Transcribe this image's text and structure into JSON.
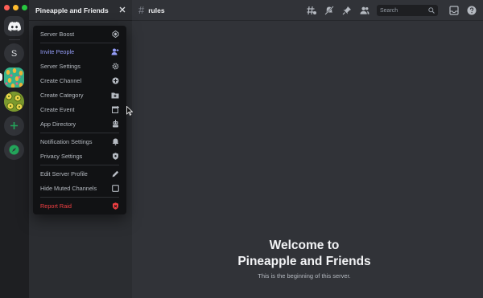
{
  "window": {
    "traffic_lights": [
      "close",
      "minimize",
      "zoom"
    ]
  },
  "rail": {
    "home_icon": "discord-logo-icon",
    "servers": [
      {
        "label": "S"
      },
      {
        "label": "",
        "icon": "pineapple-pattern-server-icon"
      },
      {
        "label": "",
        "icon": "pineapple-slices-server-icon"
      }
    ],
    "add_icon": "plus-icon",
    "explore_icon": "compass-icon"
  },
  "sidebar": {
    "server_name": "Pineapple and Friends",
    "close_icon": "close-icon"
  },
  "menu": {
    "items": [
      {
        "label": "Server Boost",
        "icon": "boost-gem-icon"
      },
      {
        "label": "Invite People",
        "icon": "add-person-icon",
        "accent": true
      },
      {
        "label": "Server Settings",
        "icon": "gear-icon"
      },
      {
        "label": "Create Channel",
        "icon": "plus-circle-icon"
      },
      {
        "label": "Create Category",
        "icon": "folder-plus-icon"
      },
      {
        "label": "Create Event",
        "icon": "calendar-plus-icon"
      },
      {
        "label": "App Directory",
        "icon": "robot-icon"
      },
      {
        "label": "Notification Settings",
        "icon": "bell-icon"
      },
      {
        "label": "Privacy Settings",
        "icon": "shield-icon"
      },
      {
        "label": "Edit Server Profile",
        "icon": "pencil-icon"
      },
      {
        "label": "Hide Muted Channels",
        "icon": "checkbox-icon"
      },
      {
        "label": "Report Raid",
        "icon": "shield-alert-icon",
        "danger": true
      }
    ]
  },
  "main": {
    "channel": {
      "hash": "#",
      "name": "rules"
    },
    "toolbar_icons": [
      "threads-icon",
      "mute-bell-icon",
      "pin-icon",
      "member-list-icon",
      "inbox-icon",
      "help-icon"
    ],
    "search": {
      "placeholder": "Search"
    },
    "welcome": {
      "line1": "Welcome to",
      "line2": "Pineapple and Friends",
      "subtitle": "This is the beginning of this server."
    }
  },
  "colors": {
    "rail_bg": "#1e1f22",
    "sidebar_bg": "#2b2d31",
    "main_bg": "#313338",
    "menu_bg": "#111214",
    "accent": "#949cf7",
    "danger": "#f23f42",
    "green": "#23a55a"
  }
}
